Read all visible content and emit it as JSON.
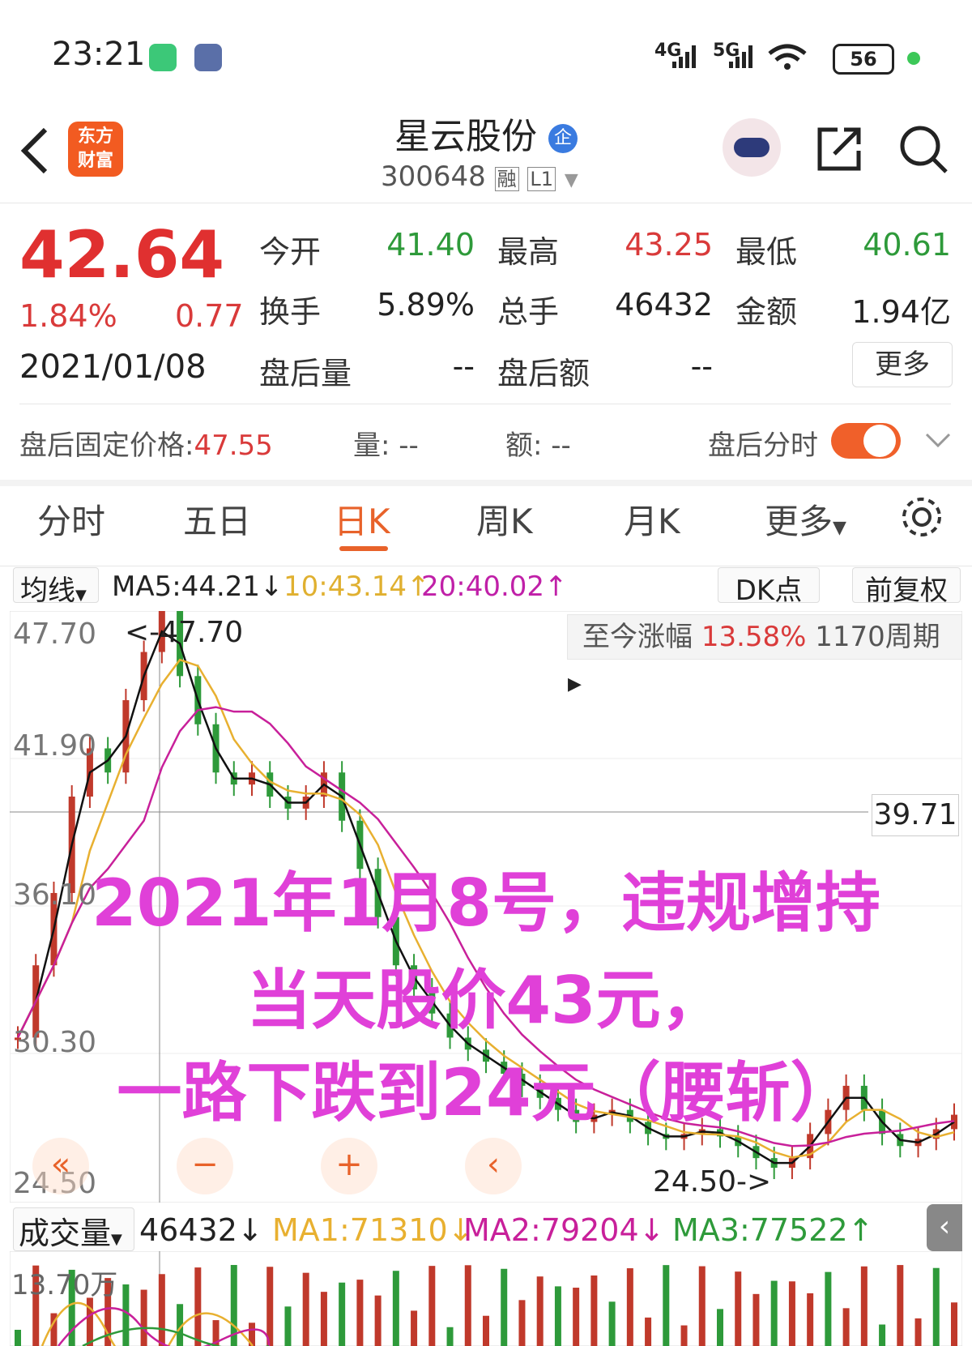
{
  "status_bar": {
    "time": "23:21",
    "net1": "4G",
    "net2": "5G",
    "battery": "56"
  },
  "header": {
    "logo_line1": "东方",
    "logo_line2": "财富",
    "title": "星云股份",
    "badge": "企",
    "code": "300648",
    "tag1": "融",
    "tag2": "L1"
  },
  "quote": {
    "price": "42.64",
    "pct": "1.84%",
    "change": "0.77",
    "date": "2021/01/08",
    "rows": [
      [
        {
          "label": "今开",
          "value": "41.40",
          "color": "green"
        },
        {
          "label": "最高",
          "value": "43.25",
          "color": "red"
        },
        {
          "label": "最低",
          "value": "40.61",
          "color": "green"
        }
      ],
      [
        {
          "label": "换手",
          "value": "5.89%",
          "color": "plain"
        },
        {
          "label": "总手",
          "value": "46432",
          "color": "plain"
        },
        {
          "label": "金额",
          "value": "1.94亿",
          "color": "plain"
        }
      ],
      [
        {
          "label": "盘后量",
          "value": "--",
          "color": "plain"
        },
        {
          "label": "盘后额",
          "value": "--",
          "color": "plain"
        }
      ]
    ],
    "more": "更多"
  },
  "after_hours": {
    "fixed_label": "盘后固定价格:",
    "fixed_value": "47.55",
    "vol_label": "量:",
    "vol_value": "--",
    "amt_label": "额:",
    "amt_value": "--",
    "intraday_label": "盘后分时"
  },
  "tabs": [
    "分时",
    "五日",
    "日K",
    "周K",
    "月K",
    "更多"
  ],
  "ma": {
    "selector": "均线",
    "ma5": "MA5:44.21",
    "ma10": "10:43.14",
    "ma20": "20:40.02",
    "dk": "DK点",
    "adjust": "前复权"
  },
  "chart": {
    "y_labels": [
      "47.70",
      "41.90",
      "36.10",
      "30.30",
      "24.50"
    ],
    "high_marker": "<-47.70",
    "low_marker": "24.50->",
    "crosshair_value": "39.71",
    "since_label": "至今涨幅",
    "since_pct": "13.58%",
    "since_period": "1170周期",
    "overlay": [
      "2021年1月8号，违规增持",
      "当天股价43元，",
      "一路下跌到24元（腰斩）"
    ]
  },
  "volume": {
    "selector": "成交量",
    "value": "46432",
    "ma1": "MA1:71310",
    "ma2": "MA2:79204",
    "ma3": "MA3:77522",
    "y_label": "13.70万"
  },
  "chart_data": {
    "type": "line",
    "ylim": [
      24.5,
      47.7
    ],
    "series": [
      {
        "values": [
          30,
          33,
          36,
          40,
          42,
          41,
          44,
          46,
          47.7,
          45,
          43,
          41,
          40.5,
          41,
          40,
          39.5,
          40,
          41,
          39,
          37,
          35,
          33,
          32,
          31,
          30,
          29.5,
          29,
          28.5,
          28,
          27.5,
          27,
          26.5,
          26.8,
          27,
          26.5,
          26,
          25.8,
          26,
          26.2,
          25.9,
          25.5,
          25,
          24.6,
          25,
          26,
          27,
          28,
          27,
          26,
          25.5,
          25.8,
          26.2,
          26.8
        ]
      }
    ]
  }
}
